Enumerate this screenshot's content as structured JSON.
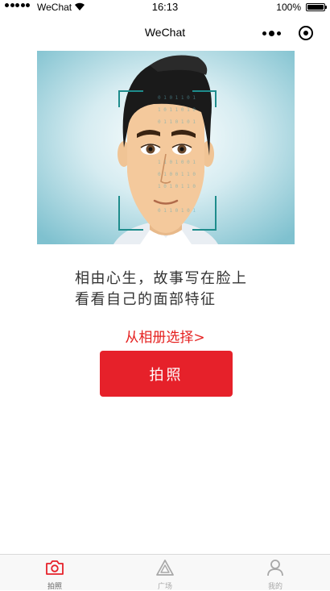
{
  "status_bar": {
    "carrier": "WeChat",
    "time": "16:13",
    "battery_pct": "100%"
  },
  "nav": {
    "title": "WeChat",
    "more_icon": "more-dots-icon",
    "close_icon": "close-circle-icon"
  },
  "hero": {
    "image_icon": "face-scan-illustration"
  },
  "slogan": {
    "line1": "相由心生，故事写在脸上",
    "line2": "看看自己的面部特征"
  },
  "actions": {
    "album_link": "从相册选择>",
    "photo_button": "拍照"
  },
  "tabbar": {
    "tabs": [
      {
        "label": "拍照",
        "icon": "camera-icon",
        "active": true
      },
      {
        "label": "广场",
        "icon": "triangle-plaza-icon",
        "active": false
      },
      {
        "label": "我的",
        "icon": "user-icon",
        "active": false
      }
    ]
  },
  "colors": {
    "accent": "#e6212a",
    "link": "#e5201f",
    "tab_inactive": "#a8a8a8"
  }
}
